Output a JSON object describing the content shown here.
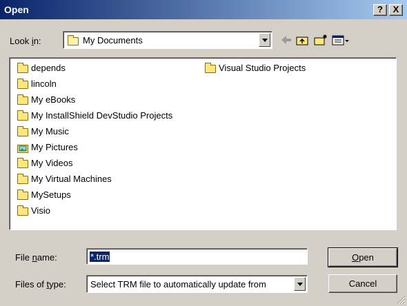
{
  "window": {
    "title": "Open",
    "help_btn": "?",
    "close_btn": "X"
  },
  "lookin": {
    "label_pre": "Look ",
    "label_key": "i",
    "label_post": "n:",
    "value": "My Documents"
  },
  "files": {
    "col1": [
      "depends",
      "lincoln",
      "My eBooks",
      "My InstallShield DevStudio Projects",
      "My Music",
      "My Pictures",
      "My Videos",
      "My Virtual Machines",
      "MySetups",
      "Visio"
    ],
    "col2": [
      "Visual Studio Projects"
    ]
  },
  "filename": {
    "label_pre": "File ",
    "label_key": "n",
    "label_post": "ame:",
    "value": "*.trm"
  },
  "filetype": {
    "label_pre": "Files of ",
    "label_key": "t",
    "label_post": "ype:",
    "value": "Select TRM file to automatically update from"
  },
  "buttons": {
    "open_key": "O",
    "open_rest": "pen",
    "cancel": "Cancel"
  },
  "colors": {
    "title_start": "#0a246a",
    "title_end": "#a6caf0",
    "selection": "#0a246a"
  }
}
